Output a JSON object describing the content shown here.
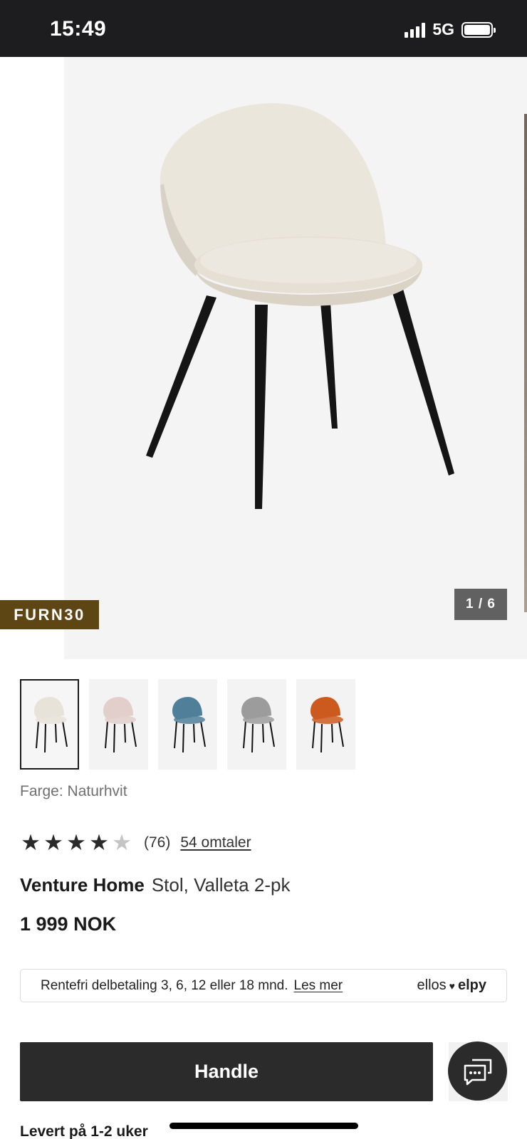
{
  "status_bar": {
    "time": "15:49",
    "network": "5G"
  },
  "gallery": {
    "promo_code": "FURN30",
    "counter": "1 / 6",
    "thumbnails": [
      {
        "color_name": "beige",
        "seat": "#e8e3d9"
      },
      {
        "color_name": "pink",
        "seat": "#e2cfcb"
      },
      {
        "color_name": "blue",
        "seat": "#4f7f99"
      },
      {
        "color_name": "grey",
        "seat": "#9c9c9c"
      },
      {
        "color_name": "orange",
        "seat": "#cc5a1f"
      }
    ]
  },
  "product": {
    "color_label": "Farge: Naturhvit",
    "rating_value": 4,
    "rating_max": 5,
    "rating_count": "(76)",
    "reviews_link": "54 omtaler",
    "brand": "Venture Home",
    "name": "Stol, Valleta 2-pk",
    "price": "1 999 NOK"
  },
  "financing": {
    "text": "Rentefri delbetaling 3, 6, 12 eller 18 mnd.",
    "link": "Les mer",
    "logo_left": "ellos",
    "logo_right": "elpy"
  },
  "actions": {
    "buy_label": "Handle"
  },
  "delivery": {
    "text": "Levert på 1-2 uker"
  },
  "colors": {
    "promo_badge": "#5e4514",
    "button": "#2b2b2b",
    "chair_seat": "#ebe6dc"
  }
}
